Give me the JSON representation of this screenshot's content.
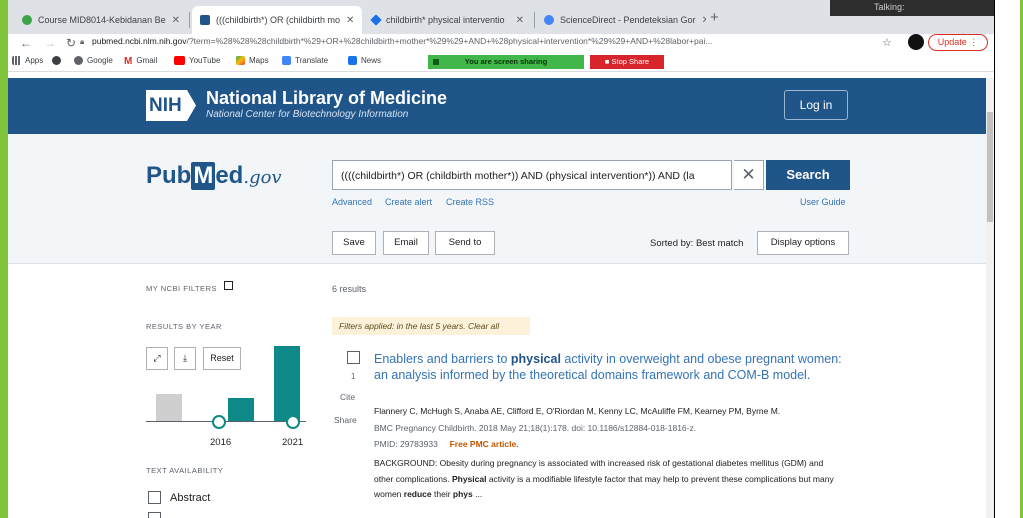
{
  "browser": {
    "tabs": [
      {
        "title": "Course MID8014-Kebidanan Be"
      },
      {
        "title": "(((childbirth*) OR (childbirth mo"
      },
      {
        "title": "childbirth* physical interventio"
      },
      {
        "title": "ScienceDirect - Pendeteksian Gor"
      }
    ],
    "talking_label": "Talking:",
    "url_host": "pubmed.ncbi.nlm.nih.gov",
    "url_path": "/?term=%28%28%28childbirth*%29+OR+%28childbirth+mother*%29%29+AND+%28physical+intervention*%29%29+AND+%28labor+pai...",
    "update_label": "Update",
    "bookmarks": [
      "Apps",
      "Google",
      "Gmail",
      "YouTube",
      "Maps",
      "Translate",
      "News"
    ],
    "screen_sharing_label": "You are screen sharing",
    "stop_share_label": "Stop Share"
  },
  "nih": {
    "logo": "NIH",
    "title": "National Library of Medicine",
    "subtitle": "National Center for Biotechnology Information",
    "login_label": "Log in"
  },
  "pubmed": {
    "logo_pub": "Pub",
    "logo_m": "M",
    "logo_ed": "ed",
    "logo_gov": ".gov",
    "query": "((((childbirth*) OR (childbirth mother*)) AND (physical intervention*)) AND (la",
    "search_label": "Search",
    "links": {
      "advanced": "Advanced",
      "create_alert": "Create alert",
      "create_rss": "Create RSS",
      "user_guide": "User Guide"
    },
    "actions": {
      "save": "Save",
      "email": "Email",
      "send_to": "Send to"
    },
    "sorted_by": "Sorted by: Best match",
    "display_options": "Display options"
  },
  "filters": {
    "my_ncbi": "MY NCBI FILTERS",
    "results_by_year": "RESULTS BY YEAR",
    "reset_label": "Reset",
    "year_start": "2016",
    "year_end": "2021",
    "text_availability": "TEXT AVAILABILITY",
    "abstract_label": "Abstract"
  },
  "results": {
    "count": "6 results",
    "filter_note": "Filters applied: in the last 5 years. Clear all",
    "items": [
      {
        "number": "1",
        "cite": "Cite",
        "share": "Share",
        "title_pre": "Enablers and barriers to ",
        "title_bold": "physical",
        "title_post": " activity in overweight and obese pregnant women: an analysis informed by the theoretical domains framework and COM-B model.",
        "authors": "Flannery C, McHugh S, Anaba AE, Clifford E, O'Riordan M, Kenny LC, McAuliffe FM, Kearney PM, Byrne M.",
        "journal": "BMC Pregnancy Childbirth. 2018 May 21;18(1):178. doi: 10.1186/s12884-018-1816-z.",
        "pmid": "PMID: 29783933",
        "pmc": "Free PMC article.",
        "snippet_1": "BACKGROUND: Obesity during pregnancy is associated with increased risk of gestational diabetes mellitus (GDM) and other complications. ",
        "snippet_b1": "Physical",
        "snippet_2": " activity is a modifiable lifestyle factor that may help to prevent these complications but many women ",
        "snippet_b2": "reduce",
        "snippet_3": " their ",
        "snippet_b3": "phys",
        "snippet_4": " ..."
      }
    ]
  },
  "colors": {
    "nih_blue": "#20558a",
    "link_blue": "#3473b5",
    "bar_gray": "#cfcfcf",
    "bar_teal": "#0d8a87",
    "filter_note_bg": "#fdf1d9"
  }
}
